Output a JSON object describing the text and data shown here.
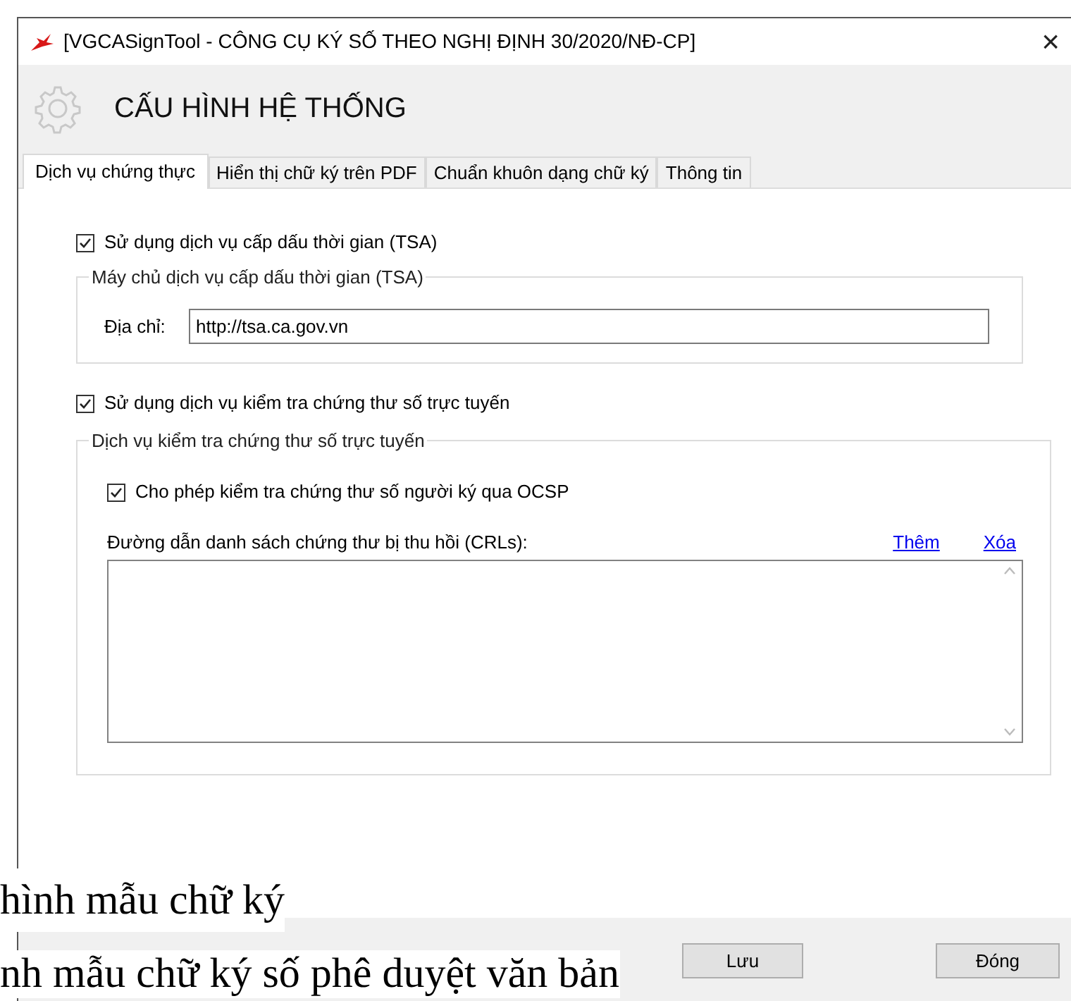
{
  "window": {
    "title": "[VGCASignTool - CÔNG CỤ KÝ SỐ THEO NGHỊ ĐỊNH 30/2020/NĐ-CP]",
    "close": "×"
  },
  "header": {
    "title": "CẤU HÌNH HỆ THỐNG"
  },
  "tabs": [
    {
      "label": "Dịch vụ chứng thực",
      "selected": true
    },
    {
      "label": "Hiển thị chữ ký trên PDF",
      "selected": false
    },
    {
      "label": "Chuẩn khuôn dạng chữ ký",
      "selected": false
    },
    {
      "label": "Thông tin",
      "selected": false
    }
  ],
  "tsa": {
    "checkbox": {
      "label": "Sử dụng dịch vụ cấp dấu thời gian (TSA)",
      "checked": true
    },
    "group": {
      "legend": "Máy chủ dịch vụ cấp dấu thời gian (TSA)",
      "address_label": "Địa chỉ:",
      "address_value": "http://tsa.ca.gov.vn"
    }
  },
  "online_check": {
    "checkbox": {
      "label": "Sử dụng dịch vụ kiểm tra chứng thư số trực tuyến",
      "checked": true
    },
    "group": {
      "legend": "Dịch vụ kiểm tra chứng thư số trực tuyến",
      "ocsp": {
        "label": "Cho phép kiểm tra chứng thư số người ký qua OCSP",
        "checked": true
      },
      "crl_label": "Đường dẫn danh sách chứng thư bị thu hồi (CRLs):",
      "links": [
        "Thêm",
        "Xóa"
      ]
    }
  },
  "buttons": [
    "Lưu",
    "Đóng"
  ],
  "background_text": [
    "hình mẫu chữ ký",
    "nh mẫu chữ ký số phê duyệt văn bản"
  ]
}
